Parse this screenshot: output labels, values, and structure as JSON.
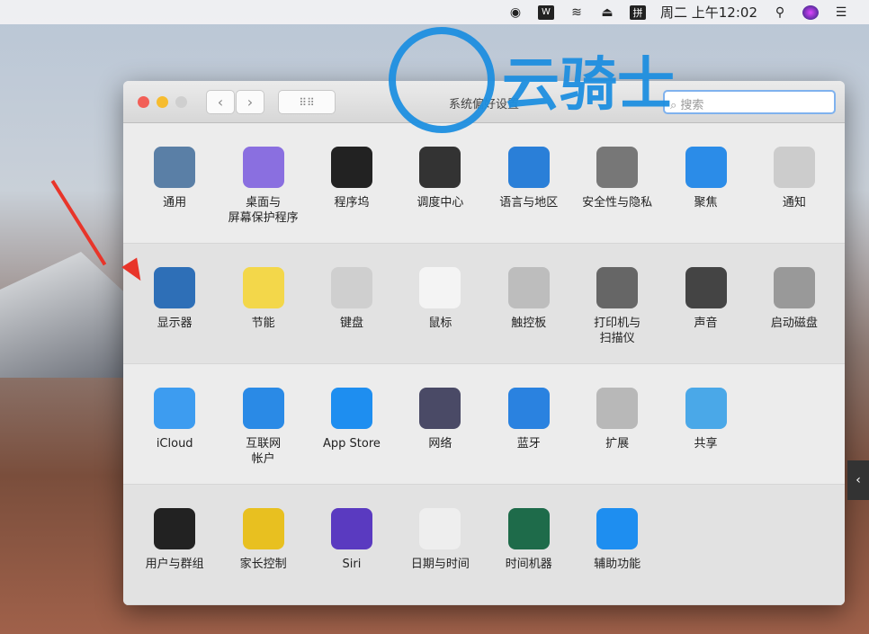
{
  "menubar": {
    "items": [
      "record-icon",
      "wps-icon",
      "wifi-icon",
      "eject-icon",
      "pinyin-input-icon"
    ],
    "clock": "周二 上午12:02"
  },
  "window": {
    "title": "系统偏好设置",
    "search_placeholder": "搜索"
  },
  "watermark": "云骑士",
  "rows": [
    [
      {
        "label": "通用",
        "icon": "general-icon",
        "color": "#5a7fa6"
      },
      {
        "label": "桌面与\n屏幕保护程序",
        "icon": "desktop-icon",
        "color": "#8a6fe0"
      },
      {
        "label": "程序坞",
        "icon": "dock-icon",
        "color": "#222"
      },
      {
        "label": "调度中心",
        "icon": "mission-control-icon",
        "color": "#333"
      },
      {
        "label": "语言与地区",
        "icon": "flag-icon",
        "color": "#2a7fd8"
      },
      {
        "label": "安全性与隐私",
        "icon": "house-lock-icon",
        "color": "#777"
      },
      {
        "label": "聚焦",
        "icon": "spotlight-icon",
        "color": "#2b8ce8"
      },
      {
        "label": "通知",
        "icon": "notifications-icon",
        "color": "#ccc"
      }
    ],
    [
      {
        "label": "显示器",
        "icon": "display-icon",
        "color": "#2e6fb7"
      },
      {
        "label": "节能",
        "icon": "bulb-icon",
        "color": "#f3d74a"
      },
      {
        "label": "键盘",
        "icon": "keyboard-icon",
        "color": "#cfcfcf"
      },
      {
        "label": "鼠标",
        "icon": "mouse-icon",
        "color": "#f4f4f4"
      },
      {
        "label": "触控板",
        "icon": "trackpad-icon",
        "color": "#bdbdbd"
      },
      {
        "label": "打印机与\n扫描仪",
        "icon": "printer-icon",
        "color": "#666"
      },
      {
        "label": "声音",
        "icon": "speaker-icon",
        "color": "#444"
      },
      {
        "label": "启动磁盘",
        "icon": "disk-icon",
        "color": "#999"
      }
    ],
    [
      {
        "label": "iCloud",
        "icon": "icloud-icon",
        "color": "#3d9cf0"
      },
      {
        "label": "互联网\n帐户",
        "icon": "at-icon",
        "color": "#2a8ae6"
      },
      {
        "label": "App Store",
        "icon": "app-store-icon",
        "color": "#1e8ef0"
      },
      {
        "label": "网络",
        "icon": "globe-icon",
        "color": "#4a4a66"
      },
      {
        "label": "蓝牙",
        "icon": "bluetooth-icon",
        "color": "#2a82e0"
      },
      {
        "label": "扩展",
        "icon": "puzzle-icon",
        "color": "#b8b8b8"
      },
      {
        "label": "共享",
        "icon": "sharing-folder-icon",
        "color": "#4aa8e8"
      }
    ],
    [
      {
        "label": "用户与群组",
        "icon": "users-icon",
        "color": "#222"
      },
      {
        "label": "家长控制",
        "icon": "parental-controls-icon",
        "color": "#e8c020"
      },
      {
        "label": "Siri",
        "icon": "siri-icon",
        "color": "#5a3ac0"
      },
      {
        "label": "日期与时间",
        "icon": "clock-icon",
        "color": "#eee"
      },
      {
        "label": "时间机器",
        "icon": "time-machine-icon",
        "color": "#1e6b4a"
      },
      {
        "label": "辅助功能",
        "icon": "accessibility-icon",
        "color": "#1e8ef0"
      }
    ]
  ]
}
